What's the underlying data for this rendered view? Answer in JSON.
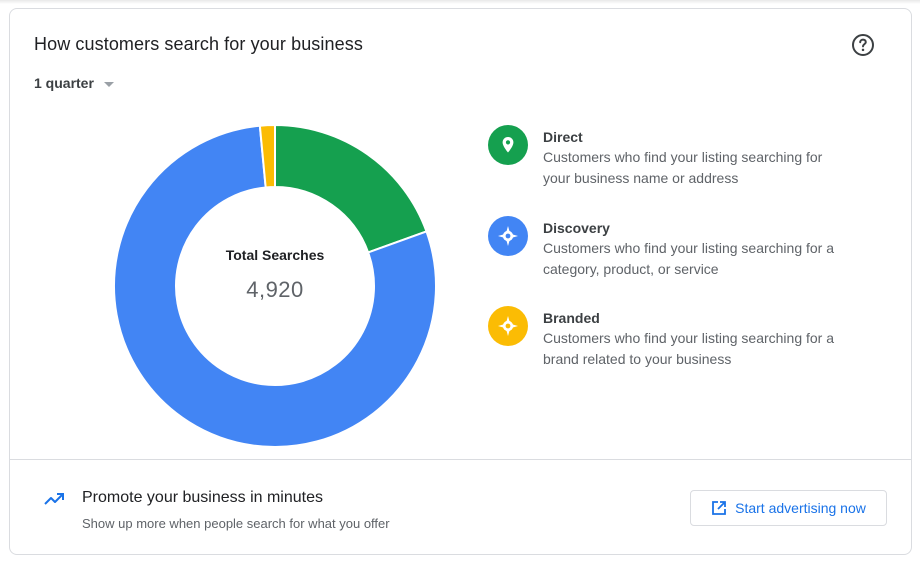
{
  "card": {
    "title": "How customers search for your business",
    "help_icon": "help-circle-icon",
    "period_selector": {
      "value": "1 quarter"
    }
  },
  "chart_data": {
    "type": "pie",
    "title": "Total Searches",
    "total": "4,920",
    "series": [
      {
        "name": "Direct",
        "value": 19.5,
        "color": "#15A04F"
      },
      {
        "name": "Discovery",
        "value": 79.0,
        "color": "#4285F4"
      },
      {
        "name": "Branded",
        "value": 1.5,
        "color": "#FBBC04"
      }
    ]
  },
  "legend": [
    {
      "title": "Direct",
      "desc_line1": "Customers who find your listing searching for",
      "desc_line2": "your business name or address",
      "icon": "location-pin-icon",
      "color": "#15A04F"
    },
    {
      "title": "Discovery",
      "desc_line1": "Customers who find your listing searching for a",
      "desc_line2": "category, product, or service",
      "icon": "compass-icon",
      "color": "#4285F4"
    },
    {
      "title": "Branded",
      "desc_line1": "Customers who find your listing searching for a",
      "desc_line2": "brand related to your business",
      "icon": "compass-icon",
      "color": "#FBBC04"
    }
  ],
  "promo": {
    "icon": "trending-up-icon",
    "title": "Promote your business in minutes",
    "subtitle": "Show up more when people search for what you offer",
    "button_label": "Start advertising now",
    "button_icon": "open-external-icon"
  }
}
